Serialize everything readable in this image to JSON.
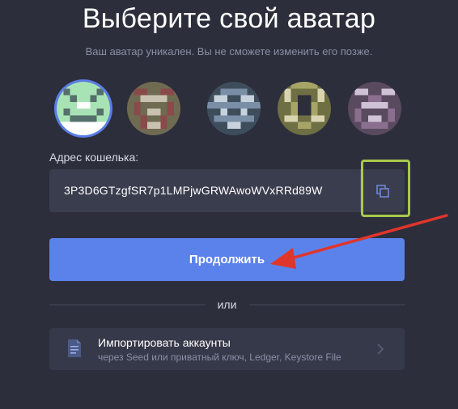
{
  "header": {
    "title": "Выберите свой аватар",
    "subtitle": "Ваш аватар уникален. Вы не сможете изменить его позже."
  },
  "avatars": {
    "selected_index": 0,
    "items": [
      {
        "name": "avatar-1",
        "colors": [
          "#a8e3b6",
          "#556f6a",
          "#ffffff"
        ]
      },
      {
        "name": "avatar-2",
        "colors": [
          "#8a4a4a",
          "#6f6a52",
          "#c9c2b0"
        ]
      },
      {
        "name": "avatar-3",
        "colors": [
          "#7a8fa6",
          "#3e4d5c",
          "#c7d2dd"
        ]
      },
      {
        "name": "avatar-4",
        "colors": [
          "#6f6f44",
          "#a7a566",
          "#d8d4b0"
        ]
      },
      {
        "name": "avatar-5",
        "colors": [
          "#5a4a60",
          "#8a6f8f",
          "#d0c2d6"
        ]
      }
    ]
  },
  "wallet": {
    "label": "Адрес кошелька:",
    "address": "3P3D6GTzgfSR7p1LMPjwGRWAwoWVxRRd89W",
    "copy_icon": "copy-icon"
  },
  "actions": {
    "continue_label": "Продолжить",
    "or_label": "или"
  },
  "import": {
    "title": "Импортировать аккаунты",
    "subtitle": "через Seed или приватный ключ, Ledger, Keystore File",
    "icon": "document-icon"
  },
  "colors": {
    "background": "#2c2e3b",
    "accent": "#5b82ea",
    "highlight": "#a8c84a",
    "annotation_arrow": "#e0352b"
  }
}
